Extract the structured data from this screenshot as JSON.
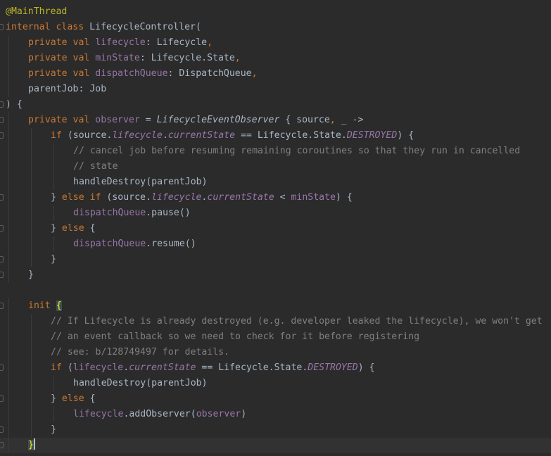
{
  "editor": {
    "language": "kotlin",
    "colors": {
      "background": "#2b2b2b",
      "current_line": "#323232",
      "keyword": "#cc7832",
      "annotation": "#bbb529",
      "property": "#9876aa",
      "comment": "#808080",
      "text": "#a9b7c6"
    },
    "lines": [
      {
        "indent": 0,
        "fold": false,
        "tokens": [
          {
            "t": "@MainThread",
            "c": "ann"
          }
        ]
      },
      {
        "indent": 0,
        "fold": true,
        "tokens": [
          {
            "t": "internal class ",
            "c": "kw"
          },
          {
            "t": "LifecycleController(",
            "c": "plain"
          }
        ]
      },
      {
        "indent": 4,
        "fold": false,
        "tokens": [
          {
            "t": "private val ",
            "c": "kw"
          },
          {
            "t": "lifecycle",
            "c": "prop"
          },
          {
            "t": ": Lifecycle",
            "c": "plain"
          },
          {
            "t": ",",
            "c": "kw"
          }
        ]
      },
      {
        "indent": 4,
        "fold": false,
        "tokens": [
          {
            "t": "private val ",
            "c": "kw"
          },
          {
            "t": "minState",
            "c": "prop"
          },
          {
            "t": ": Lifecycle.State",
            "c": "plain"
          },
          {
            "t": ",",
            "c": "kw"
          }
        ]
      },
      {
        "indent": 4,
        "fold": false,
        "tokens": [
          {
            "t": "private val ",
            "c": "kw"
          },
          {
            "t": "dispatchQueue",
            "c": "prop"
          },
          {
            "t": ": DispatchQueue",
            "c": "plain"
          },
          {
            "t": ",",
            "c": "kw"
          }
        ]
      },
      {
        "indent": 4,
        "fold": false,
        "tokens": [
          {
            "t": "parentJob: Job",
            "c": "plain"
          }
        ]
      },
      {
        "indent": 0,
        "fold": true,
        "tokens": [
          {
            "t": ") {",
            "c": "plain"
          }
        ]
      },
      {
        "indent": 4,
        "fold": true,
        "tokens": [
          {
            "t": "private val ",
            "c": "kw"
          },
          {
            "t": "observer",
            "c": "prop"
          },
          {
            "t": " = ",
            "c": "plain"
          },
          {
            "t": "LifecycleEventObserver",
            "c": "ital"
          },
          {
            "t": " { source",
            "c": "plain"
          },
          {
            "t": ", ",
            "c": "kw"
          },
          {
            "t": "_ ->",
            "c": "plain"
          }
        ]
      },
      {
        "indent": 8,
        "fold": true,
        "tokens": [
          {
            "t": "if ",
            "c": "kw"
          },
          {
            "t": "(source.",
            "c": "plain"
          },
          {
            "t": "lifecycle",
            "c": "prop ital"
          },
          {
            "t": ".",
            "c": "plain"
          },
          {
            "t": "currentState",
            "c": "prop ital"
          },
          {
            "t": " == Lifecycle.State.",
            "c": "plain"
          },
          {
            "t": "DESTROYED",
            "c": "prop ital"
          },
          {
            "t": ") {",
            "c": "plain"
          }
        ]
      },
      {
        "indent": 12,
        "fold": false,
        "tokens": [
          {
            "t": "// cancel job before resuming remaining coroutines so that they run in cancelled",
            "c": "cmt"
          }
        ]
      },
      {
        "indent": 12,
        "fold": false,
        "tokens": [
          {
            "t": "// state",
            "c": "cmt"
          }
        ]
      },
      {
        "indent": 12,
        "fold": false,
        "tokens": [
          {
            "t": "handleDestroy(parentJob)",
            "c": "plain"
          }
        ]
      },
      {
        "indent": 8,
        "fold": true,
        "tokens": [
          {
            "t": "} ",
            "c": "plain"
          },
          {
            "t": "else if ",
            "c": "kw"
          },
          {
            "t": "(source.",
            "c": "plain"
          },
          {
            "t": "lifecycle",
            "c": "prop ital"
          },
          {
            "t": ".",
            "c": "plain"
          },
          {
            "t": "currentState",
            "c": "prop ital"
          },
          {
            "t": " < ",
            "c": "plain"
          },
          {
            "t": "minState",
            "c": "prop"
          },
          {
            "t": ") {",
            "c": "plain"
          }
        ]
      },
      {
        "indent": 12,
        "fold": false,
        "tokens": [
          {
            "t": "dispatchQueue",
            "c": "prop"
          },
          {
            "t": ".pause()",
            "c": "plain"
          }
        ]
      },
      {
        "indent": 8,
        "fold": true,
        "tokens": [
          {
            "t": "} ",
            "c": "plain"
          },
          {
            "t": "else ",
            "c": "kw"
          },
          {
            "t": "{",
            "c": "plain"
          }
        ]
      },
      {
        "indent": 12,
        "fold": false,
        "tokens": [
          {
            "t": "dispatchQueue",
            "c": "prop"
          },
          {
            "t": ".resume()",
            "c": "plain"
          }
        ]
      },
      {
        "indent": 8,
        "fold": true,
        "tokens": [
          {
            "t": "}",
            "c": "plain"
          }
        ]
      },
      {
        "indent": 4,
        "fold": true,
        "tokens": [
          {
            "t": "}",
            "c": "plain"
          }
        ]
      },
      {
        "indent": 0,
        "fold": false,
        "tokens": []
      },
      {
        "indent": 4,
        "fold": true,
        "tokens": [
          {
            "t": "init ",
            "c": "kw"
          },
          {
            "t": "{",
            "c": "brace-hl"
          }
        ]
      },
      {
        "indent": 8,
        "fold": false,
        "tokens": [
          {
            "t": "// If Lifecycle is already destroyed (e.g. developer leaked the lifecycle), we won't get",
            "c": "cmt"
          }
        ]
      },
      {
        "indent": 8,
        "fold": false,
        "tokens": [
          {
            "t": "// an event callback so we need to check for it before registering",
            "c": "cmt"
          }
        ]
      },
      {
        "indent": 8,
        "fold": false,
        "tokens": [
          {
            "t": "// see: b/128749497 for details.",
            "c": "cmt"
          }
        ]
      },
      {
        "indent": 8,
        "fold": true,
        "tokens": [
          {
            "t": "if ",
            "c": "kw"
          },
          {
            "t": "(",
            "c": "plain"
          },
          {
            "t": "lifecycle",
            "c": "prop"
          },
          {
            "t": ".",
            "c": "plain"
          },
          {
            "t": "currentState",
            "c": "prop ital"
          },
          {
            "t": " == Lifecycle.State.",
            "c": "plain"
          },
          {
            "t": "DESTROYED",
            "c": "prop ital"
          },
          {
            "t": ") {",
            "c": "plain"
          }
        ]
      },
      {
        "indent": 12,
        "fold": false,
        "tokens": [
          {
            "t": "handleDestroy(parentJob)",
            "c": "plain"
          }
        ]
      },
      {
        "indent": 8,
        "fold": true,
        "tokens": [
          {
            "t": "} ",
            "c": "plain"
          },
          {
            "t": "else ",
            "c": "kw"
          },
          {
            "t": "{",
            "c": "plain"
          }
        ]
      },
      {
        "indent": 12,
        "fold": false,
        "tokens": [
          {
            "t": "lifecycle",
            "c": "prop"
          },
          {
            "t": ".addObserver(",
            "c": "plain"
          },
          {
            "t": "observer",
            "c": "prop"
          },
          {
            "t": ")",
            "c": "plain"
          }
        ]
      },
      {
        "indent": 8,
        "fold": true,
        "tokens": [
          {
            "t": "}",
            "c": "plain"
          }
        ]
      },
      {
        "indent": 4,
        "fold": true,
        "current": true,
        "caret": true,
        "tokens": [
          {
            "t": "}",
            "c": "brace-hl"
          }
        ]
      }
    ]
  }
}
